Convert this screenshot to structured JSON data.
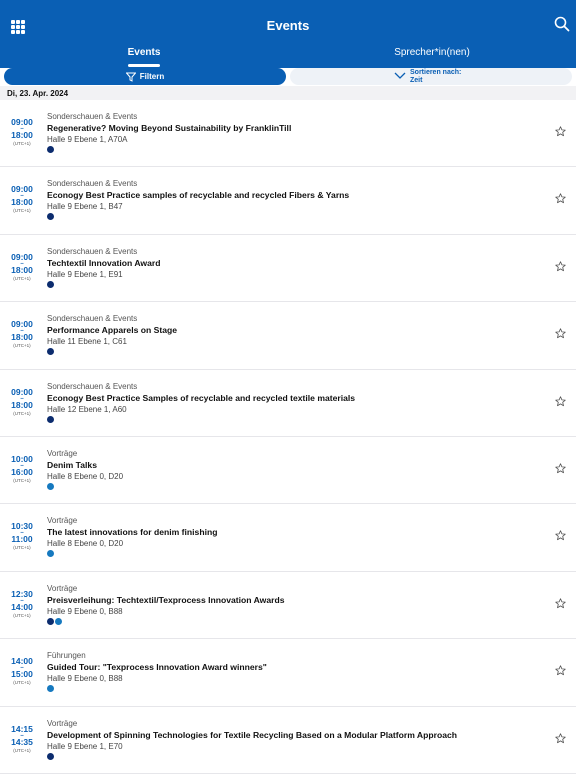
{
  "header": {
    "title": "Events"
  },
  "tabs": [
    {
      "label": "Events",
      "active": true
    },
    {
      "label": "Sprecher*in(nen)",
      "active": false
    }
  ],
  "toolbar": {
    "filter_label": "Filtern",
    "sort_line1": "Sortieren nach:",
    "sort_line2": "Zeit"
  },
  "date_header": "Di, 23. Apr. 2024",
  "colors": {
    "primary": "#0a5fb4",
    "dot_dark": "#0c2c6e",
    "dot_light": "#1679bf"
  },
  "events": [
    {
      "start": "09:00",
      "sep": "–",
      "end": "18:00",
      "tz": "(UTC+1)",
      "category": "Sonderschauen & Events",
      "title": "Regenerative? Moving Beyond Sustainability by FranklinTill",
      "location": "Halle 9 Ebene 1, A70A",
      "dots": [
        "#0c2c6e"
      ]
    },
    {
      "start": "09:00",
      "sep": "–",
      "end": "18:00",
      "tz": "(UTC+1)",
      "category": "Sonderschauen & Events",
      "title": "Econogy Best Practice samples of recyclable and recycled Fibers & Yarns",
      "location": "Halle 9 Ebene 1, B47",
      "dots": [
        "#0c2c6e"
      ]
    },
    {
      "start": "09:00",
      "sep": "–",
      "end": "18:00",
      "tz": "(UTC+1)",
      "category": "Sonderschauen & Events",
      "title": "Techtextil Innovation Award",
      "location": "Halle 9 Ebene 1, E91",
      "dots": [
        "#0c2c6e"
      ]
    },
    {
      "start": "09:00",
      "sep": "–",
      "end": "18:00",
      "tz": "(UTC+1)",
      "category": "Sonderschauen & Events",
      "title": "Performance Apparels on Stage",
      "location": "Halle 11 Ebene 1, C61",
      "dots": [
        "#0c2c6e"
      ]
    },
    {
      "start": "09:00",
      "sep": "–",
      "end": "18:00",
      "tz": "(UTC+1)",
      "category": "Sonderschauen & Events",
      "title": "Econogy Best Practice Samples of recyclable and recycled textile materials",
      "location": "Halle 12 Ebene 1, A60",
      "dots": [
        "#0c2c6e"
      ]
    },
    {
      "start": "10:00",
      "sep": "–",
      "end": "16:00",
      "tz": "(UTC+1)",
      "category": "Vorträge",
      "title": "Denim Talks",
      "location": "Halle 8 Ebene 0, D20",
      "dots": [
        "#1679bf"
      ]
    },
    {
      "start": "10:30",
      "sep": "–",
      "end": "11:00",
      "tz": "(UTC+1)",
      "category": "Vorträge",
      "title": "The latest innovations for denim finishing",
      "location": "Halle 8 Ebene 0, D20",
      "dots": [
        "#1679bf"
      ]
    },
    {
      "start": "12:30",
      "sep": "–",
      "end": "14:00",
      "tz": "(UTC+1)",
      "category": "Vorträge",
      "title": "Preisverleihung: Techtextil/Texprocess Innovation Awards",
      "location": "Halle 9 Ebene 0, B88",
      "dots": [
        "#0c2c6e",
        "#1679bf"
      ]
    },
    {
      "start": "14:00",
      "sep": "–",
      "end": "15:00",
      "tz": "(UTC+1)",
      "category": "Führungen",
      "title": "Guided Tour: \"Texprocess Innovation Award winners\"",
      "location": "Halle 9 Ebene 0, B88",
      "dots": [
        "#1679bf"
      ]
    },
    {
      "start": "14:15",
      "sep": "–",
      "end": "14:35",
      "tz": "(UTC+1)",
      "category": "Vorträge",
      "title": "Development of Spinning Technologies for Textile Recycling Based on a Modular Platform Approach",
      "location": "Halle 9 Ebene 1, E70",
      "dots": [
        "#0c2c6e"
      ]
    }
  ]
}
